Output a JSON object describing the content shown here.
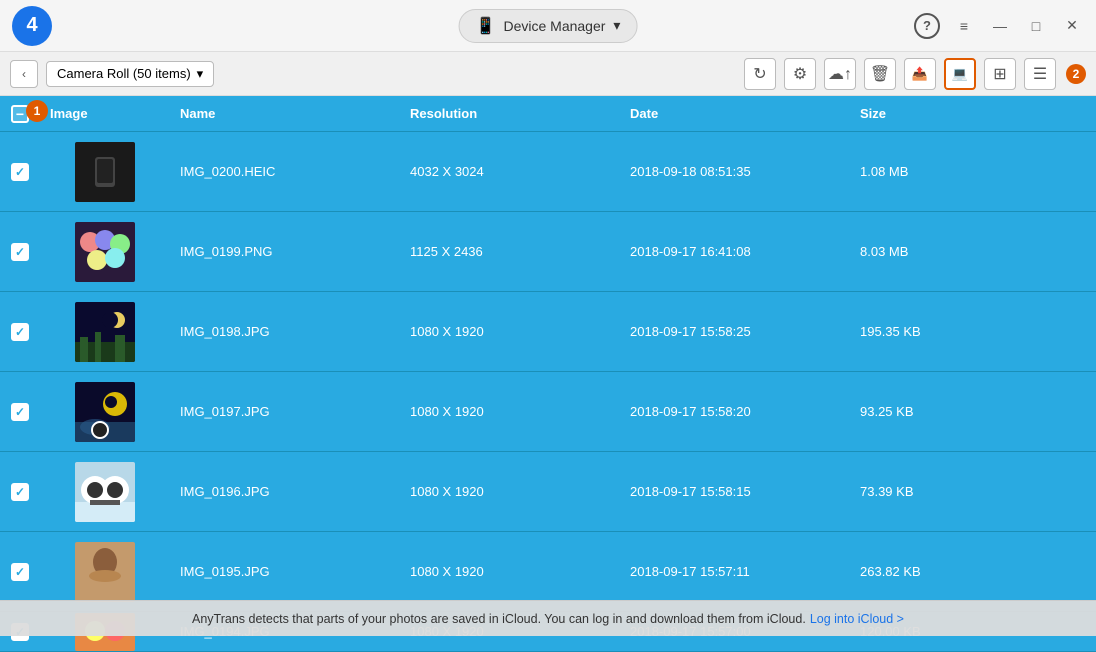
{
  "titlebar": {
    "app_logo": "4",
    "device_manager_label": "Device Manager",
    "device_icon": "📱",
    "dropdown_arrow": "▾",
    "controls": {
      "help": "?",
      "menu": "≡",
      "minimize": "—",
      "restore": "□",
      "close": "✕"
    }
  },
  "toolbar": {
    "back_arrow": "‹",
    "folder_label": "Camera Roll (50 items)",
    "folder_arrow": "▾",
    "buttons": {
      "refresh": "↻",
      "settings": "⚙",
      "upload": "↑",
      "delete": "🗑",
      "export": "↗",
      "save_to_pc": "💾",
      "grid_view": "⊞",
      "list_view": "≡"
    },
    "step2_label": "2"
  },
  "table": {
    "headers": [
      "Image",
      "Name",
      "Resolution",
      "Date",
      "Size"
    ],
    "rows": [
      {
        "checked": true,
        "name": "IMG_0200.HEIC",
        "resolution": "4032 X 3024",
        "date": "2018-09-18 08:51:35",
        "size": "1.08 MB",
        "thumb_type": "dark"
      },
      {
        "checked": true,
        "name": "IMG_0199.PNG",
        "resolution": "1125 X 2436",
        "date": "2018-09-17 16:41:08",
        "size": "8.03 MB",
        "thumb_type": "colorful"
      },
      {
        "checked": true,
        "name": "IMG_0198.JPG",
        "resolution": "1080 X 1920",
        "date": "2018-09-17 15:58:25",
        "size": "195.35 KB",
        "thumb_type": "night"
      },
      {
        "checked": true,
        "name": "IMG_0197.JPG",
        "resolution": "1080 X 1920",
        "date": "2018-09-17 15:58:20",
        "size": "93.25 KB",
        "thumb_type": "moon"
      },
      {
        "checked": true,
        "name": "IMG_0196.JPG",
        "resolution": "1080 X 1920",
        "date": "2018-09-17 15:58:15",
        "size": "73.39 KB",
        "thumb_type": "panda"
      },
      {
        "checked": true,
        "name": "IMG_0195.JPG",
        "resolution": "1080 X 1920",
        "date": "2018-09-17 15:57:11",
        "size": "263.82 KB",
        "thumb_type": "portrait"
      },
      {
        "checked": true,
        "name": "IMG_0194.JPG",
        "resolution": "1080 X 1920",
        "date": "2018-09-17 15:57:00",
        "size": "120.00 KB",
        "thumb_type": "colorful2"
      }
    ]
  },
  "notification": {
    "text": "AnyTrans detects that parts of your photos are saved in iCloud. You can log in and download them from iCloud.",
    "link_text": "Log into iCloud >",
    "link_url": "#"
  },
  "badges": {
    "step1": "1",
    "step2": "2"
  }
}
